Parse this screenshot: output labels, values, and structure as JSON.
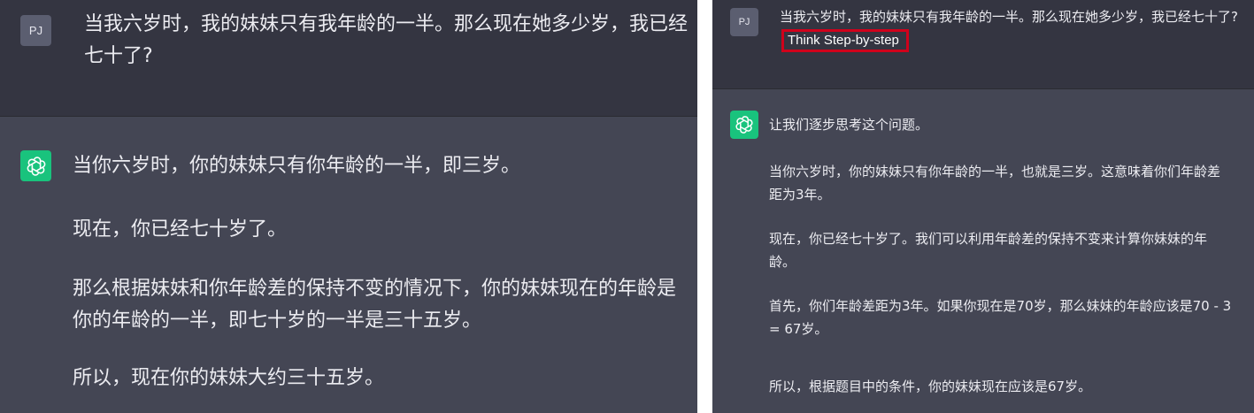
{
  "left": {
    "user_avatar": "PJ",
    "user_message": "当我六岁时，我的妹妹只有我年龄的一半。那么现在她多少岁，我已经七十了?",
    "bot_avatar_icon": "openai-logo-icon",
    "response": [
      "当你六岁时，你的妹妹只有你年龄的一半，即三岁。",
      "现在，你已经七十岁了。",
      "那么根据妹妹和你年龄差的保持不变的情况下，你的妹妹现在的年龄是你的年龄的一半，即七十岁的一半是三十五岁。",
      "所以，现在你的妹妹大约三十五岁。"
    ]
  },
  "right": {
    "user_avatar": "PJ",
    "user_message": "当我六岁时，我的妹妹只有我年龄的一半。那么现在她多少岁，我已经七十了?",
    "prompt_suffix": "Think Step-by-step",
    "bot_avatar_icon": "openai-logo-icon",
    "response": [
      "让我们逐步思考这个问题。",
      "当你六岁时，你的妹妹只有你年龄的一半，也就是三岁。这意味着你们年龄差距为3年。",
      "现在，你已经七十岁了。我们可以利用年龄差的保持不变来计算你妹妹的年龄。",
      "首先，你们年龄差距为3年。如果你现在是70岁，那么妹妹的年龄应该是70 - 3 = 67岁。",
      "所以，根据题目中的条件，你的妹妹现在应该是67岁。"
    ]
  },
  "colors": {
    "user_row_bg": "#343541",
    "assistant_bg": "#444654",
    "bot_avatar_bg": "#19c37d",
    "highlight_border": "#d0011b"
  }
}
